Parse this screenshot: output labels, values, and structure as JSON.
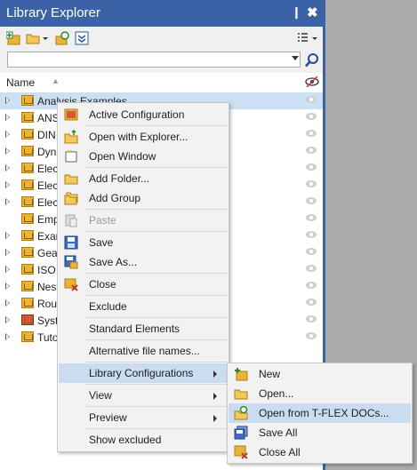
{
  "panel": {
    "title": "Library Explorer",
    "pin_glyph": "❙",
    "close_glyph": "✖"
  },
  "search": {
    "value": "",
    "placeholder": ""
  },
  "column": {
    "name": "Name"
  },
  "tree": [
    {
      "label": "Analysis Examples",
      "selected": true
    },
    {
      "label": "ANS"
    },
    {
      "label": "DIN"
    },
    {
      "label": "Dyn"
    },
    {
      "label": "Elec"
    },
    {
      "label": "Elec"
    },
    {
      "label": "Elec"
    },
    {
      "label": "Emp"
    },
    {
      "label": "Exar"
    },
    {
      "label": "Gear"
    },
    {
      "label": "ISO"
    },
    {
      "label": "Nest"
    },
    {
      "label": "Rout"
    },
    {
      "label": "Syst"
    },
    {
      "label": "Tuto"
    }
  ],
  "context_menu": {
    "active_configuration": "Active Configuration",
    "open_with_explorer": "Open with Explorer...",
    "open_window": "Open Window",
    "add_folder": "Add Folder...",
    "add_group": "Add Group",
    "paste": "Paste",
    "save": "Save",
    "save_as": "Save As...",
    "close": "Close",
    "exclude": "Exclude",
    "standard_elements": "Standard Elements",
    "alternative_file_names": "Alternative file names...",
    "library_configurations": "Library Configurations",
    "view": "View",
    "preview": "Preview",
    "show_excluded": "Show excluded"
  },
  "submenu": {
    "new": "New",
    "open": "Open...",
    "open_from_tflex_docs": "Open from T-FLEX DOCs...",
    "save_all": "Save All",
    "close_all": "Close All"
  },
  "colors": {
    "title_bar": "#3c62a6",
    "highlight": "#c9dcf0",
    "folder": "#e8b53a"
  }
}
